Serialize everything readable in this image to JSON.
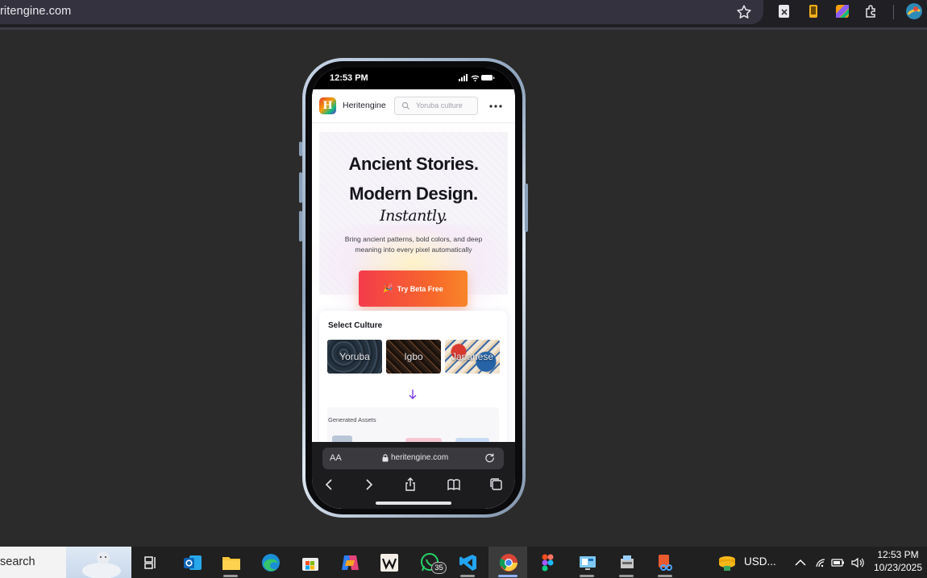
{
  "browser": {
    "url": "ritengine.com"
  },
  "phone": {
    "status_time": "12:53 PM",
    "site": {
      "logo_letter": "H",
      "brand": "Heritengine",
      "search_placeholder": "Yoruba culture"
    },
    "hero": {
      "line1": "Ancient Stories.",
      "line2": "Modern Design.",
      "line3": "Instantly.",
      "description": "Bring ancient patterns, bold colors, and deep meaning into every pixel automatically",
      "cta_icon": "🎉",
      "cta_label": "Try Beta Free"
    },
    "culture": {
      "title": "Select Culture",
      "options": [
        "Yoruba",
        "Igbo",
        "Japanese"
      ],
      "assets_label": "Generated Assets"
    },
    "safari": {
      "aa": "AA",
      "url": "heritengine.com"
    }
  },
  "taskbar": {
    "search_text": "search",
    "whatsapp_badge": "35",
    "currency": "USD...",
    "time": "12:53 PM",
    "date": "10/23/2025"
  },
  "colors": {
    "accent_gradient_start": "#f43b4c",
    "accent_gradient_end": "#f9862a",
    "desktop_background": "#2b2b2b"
  }
}
